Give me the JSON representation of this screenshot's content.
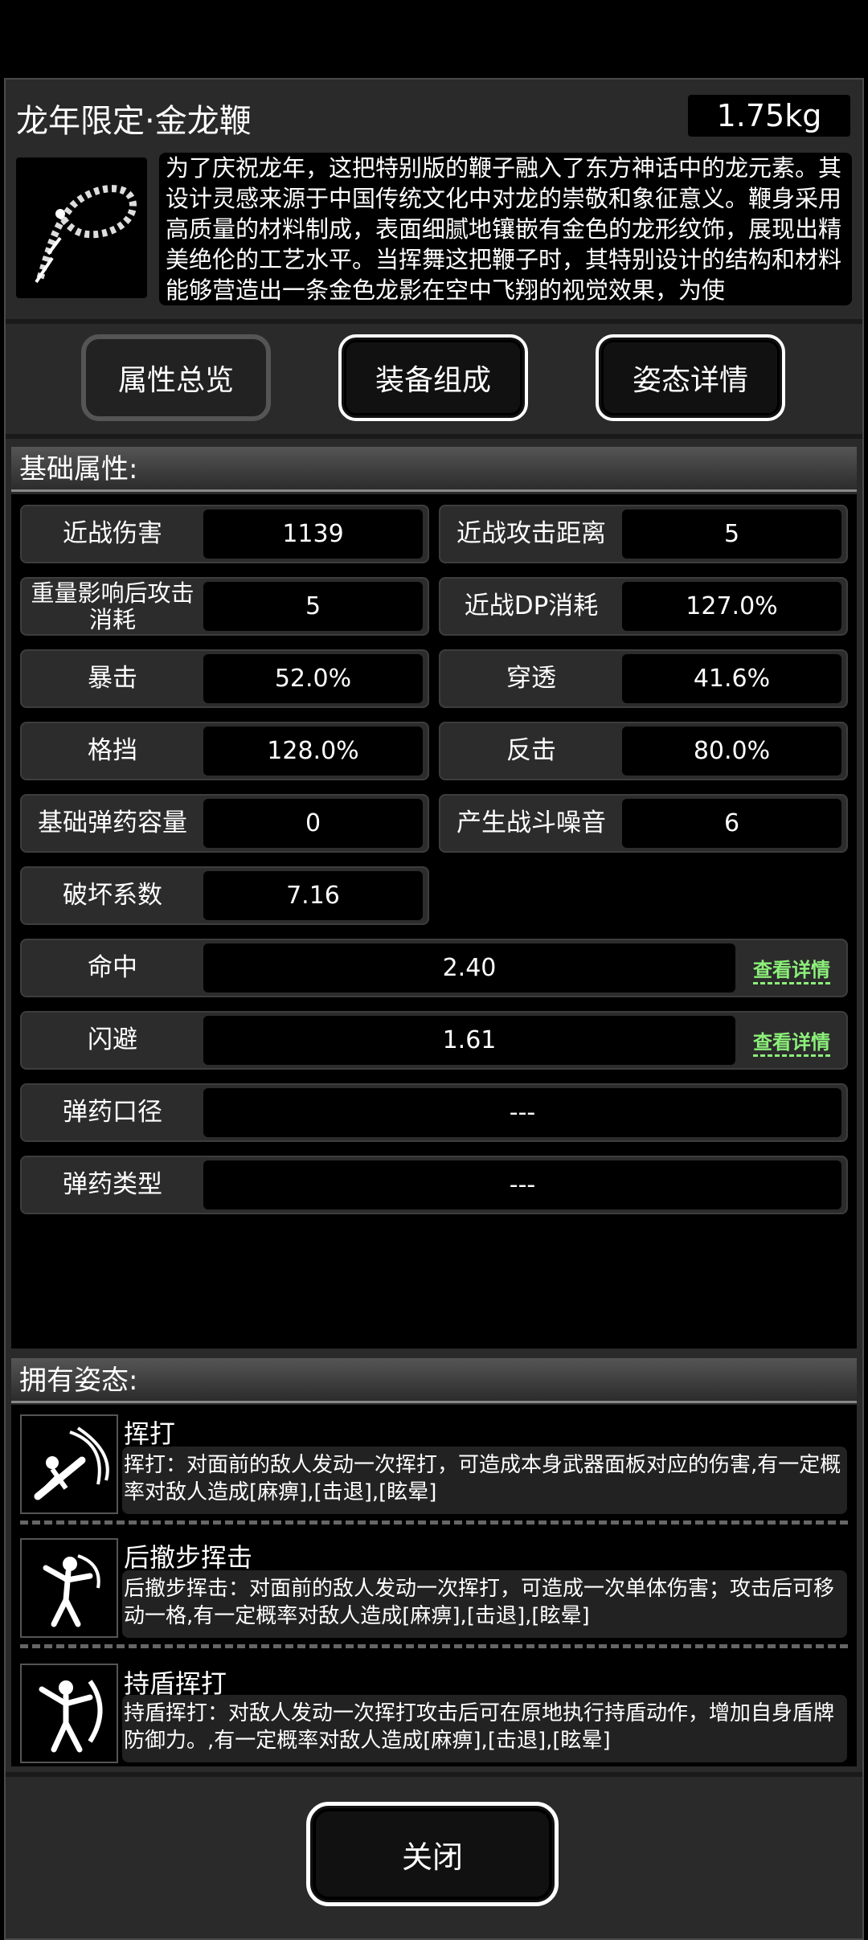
{
  "item": {
    "name": "龙年限定·金龙鞭",
    "weight": "1.75kg",
    "description": "为了庆祝龙年，这把特别版的鞭子融入了东方神话中的龙元素。其设计灵感来源于中国传统文化中对龙的崇敬和象征意义。鞭身采用高质量的材料制成，表面细腻地镶嵌有金色的龙形纹饰，展现出精美绝伦的工艺水平。当挥舞这把鞭子时，其特别设计的结构和材料能够营造出一条金色龙影在空中飞翔的视觉效果，为使"
  },
  "tabs": [
    "属性总览",
    "装备组成",
    "姿态详情"
  ],
  "basic_header": "基础属性:",
  "stats": [
    {
      "label": "近战伤害",
      "value": "1139"
    },
    {
      "label": "近战攻击距离",
      "value": "5"
    },
    {
      "label": "重量影响后攻击消耗",
      "value": "5"
    },
    {
      "label": "近战DP消耗",
      "value": "127.0%"
    },
    {
      "label": "暴击",
      "value": "52.0%"
    },
    {
      "label": "穿透",
      "value": "41.6%"
    },
    {
      "label": "格挡",
      "value": "128.0%"
    },
    {
      "label": "反击",
      "value": "80.0%"
    },
    {
      "label": "基础弹药容量",
      "value": "0"
    },
    {
      "label": "产生战斗噪音",
      "value": "6"
    },
    {
      "label": "破坏系数",
      "value": "7.16"
    }
  ],
  "wide_stats": [
    {
      "label": "命中",
      "value": "2.40",
      "link": "查看详情"
    },
    {
      "label": "闪避",
      "value": "1.61",
      "link": "查看详情"
    },
    {
      "label": "弹药口径",
      "value": "---"
    },
    {
      "label": "弹药类型",
      "value": "---"
    }
  ],
  "poses_header": "拥有姿态:",
  "poses": [
    {
      "name": "挥打",
      "desc": "挥打：对面前的敌人发动一次挥打，可造成本身武器面板对应的伤害,有一定概率对敌人造成[麻痹],[击退],[眩晕]",
      "icon": "swing-icon"
    },
    {
      "name": "后撤步挥击",
      "desc": "后撤步挥击：对面前的敌人发动一次挥打，可造成一次单体伤害；攻击后可移动一格,有一定概率对敌人造成[麻痹],[击退],[眩晕]",
      "icon": "backstep-strike-icon"
    },
    {
      "name": "持盾挥打",
      "desc": "持盾挥打：对敌人发动一次挥打攻击后可在原地执行持盾动作，增加自身盾牌防御力。,有一定概率对敌人造成[麻痹],[击退],[眩晕]",
      "icon": "shield-swing-icon"
    }
  ],
  "close_label": "关闭"
}
